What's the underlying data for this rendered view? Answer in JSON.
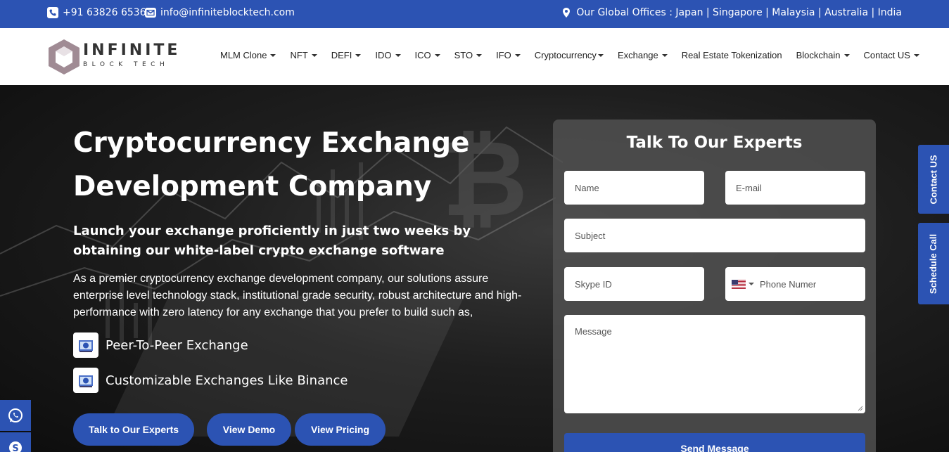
{
  "topbar": {
    "phone": "+91 63826 65366",
    "email": "info@infiniteblocktech.com",
    "offices": "Our Global Offices : Japan | Singapore | Malaysia | Australia | India"
  },
  "logo": {
    "main": "INFINITE",
    "sub": "BLOCK TECH"
  },
  "nav": {
    "items": [
      {
        "label": "MLM Clone"
      },
      {
        "label": "NFT"
      },
      {
        "label": "DEFI"
      },
      {
        "label": "IDO"
      },
      {
        "label": "ICO"
      },
      {
        "label": "STO"
      },
      {
        "label": "IFO"
      },
      {
        "label": "Cryptocurrency"
      },
      {
        "label": "Exchange"
      },
      {
        "label": "Real Estate Tokenization"
      },
      {
        "label": "Blockchain"
      },
      {
        "label": "Contact US"
      }
    ]
  },
  "hero": {
    "title": "Cryptocurrency Exchange Development Company",
    "subtitle": "Launch your exchange proficiently in just two weeks by obtaining our white-label crypto exchange software",
    "description": "As a premier cryptocurrency exchange development company, our solutions assure enterprise level technology stack, institutional grade security, robust architecture and high-performance with zero latency for any exchange that you prefer to build such as,",
    "features": [
      "Peer-To-Peer Exchange",
      "Customizable Exchanges Like Binance"
    ],
    "buttons": {
      "experts": "Talk to Our Experts",
      "demo": "View Demo",
      "pricing": "View Pricing"
    }
  },
  "form": {
    "title": "Talk To Our Experts",
    "name_placeholder": "Name",
    "email_placeholder": "E-mail",
    "subject_placeholder": "Subject",
    "skype_placeholder": "Skype ID",
    "phone_placeholder": "Phone Numer",
    "message_placeholder": "Message",
    "send_label": "Send Message"
  },
  "side_tabs": {
    "contact": "Contact US",
    "schedule": "Schedule Call"
  },
  "colors": {
    "primary": "#2c53b3"
  }
}
